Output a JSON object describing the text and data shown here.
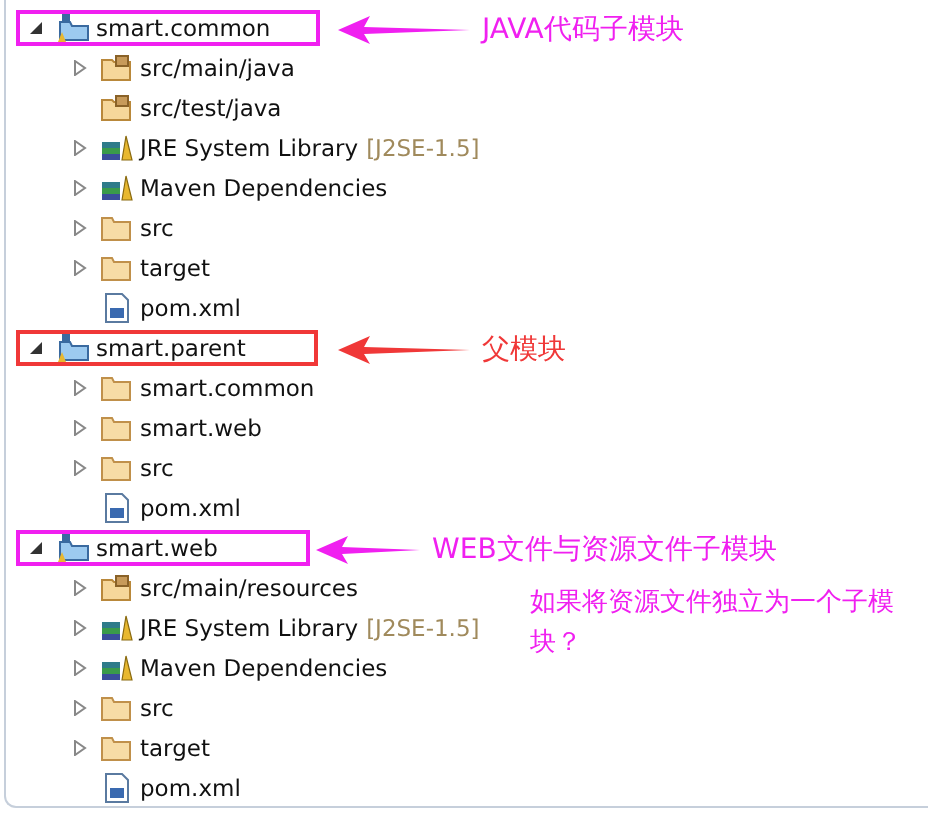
{
  "projects": [
    {
      "name": "smart.common",
      "expanded": true,
      "color": "#f020f0",
      "notes": [
        "JAVA代码子模块"
      ],
      "children": [
        {
          "kind": "source",
          "label": "src/main/java",
          "expandable": true
        },
        {
          "kind": "source",
          "label": "src/test/java",
          "expandable": false
        },
        {
          "kind": "library",
          "label": "JRE System Library",
          "decoration": "[J2SE-1.5]",
          "expandable": true
        },
        {
          "kind": "library",
          "label": "Maven Dependencies",
          "expandable": true
        },
        {
          "kind": "folder",
          "label": "src",
          "expandable": true
        },
        {
          "kind": "folder",
          "label": "target",
          "expandable": true
        },
        {
          "kind": "pom",
          "label": "pom.xml",
          "expandable": false
        }
      ]
    },
    {
      "name": "smart.parent",
      "expanded": true,
      "color": "#f03838",
      "notes": [
        "父模块"
      ],
      "children": [
        {
          "kind": "folder",
          "label": "smart.common",
          "expandable": true
        },
        {
          "kind": "folder",
          "label": "smart.web",
          "expandable": true
        },
        {
          "kind": "folder",
          "label": "src",
          "expandable": true
        },
        {
          "kind": "pom",
          "label": "pom.xml",
          "expandable": false
        }
      ]
    },
    {
      "name": "smart.web",
      "expanded": true,
      "color": "#f020f0",
      "notes": [
        "WEB文件与资源文件子模块",
        "如果将资源文件独立为一个子模块？"
      ],
      "children": [
        {
          "kind": "source",
          "label": "src/main/resources",
          "expandable": true
        },
        {
          "kind": "library",
          "label": "JRE System Library",
          "decoration": "[J2SE-1.5]",
          "expandable": true
        },
        {
          "kind": "library",
          "label": "Maven Dependencies",
          "expandable": true
        },
        {
          "kind": "folder",
          "label": "src",
          "expandable": true
        },
        {
          "kind": "folder",
          "label": "target",
          "expandable": true
        },
        {
          "kind": "pom",
          "label": "pom.xml",
          "expandable": false
        }
      ]
    }
  ]
}
